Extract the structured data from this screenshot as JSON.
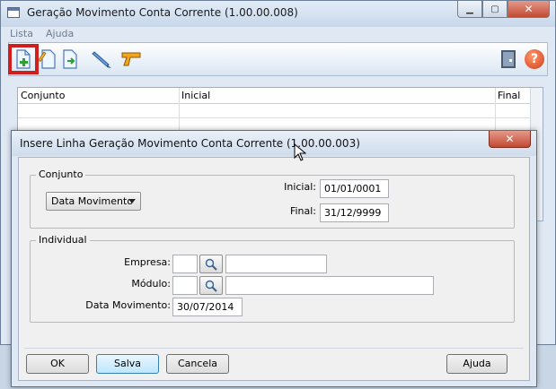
{
  "main_window": {
    "title": "Geração Movimento Conta Corrente (1.00.00.008)",
    "controls": {
      "minimize": "▁",
      "maximize": "▢",
      "close": "✕"
    }
  },
  "menu": {
    "items": [
      "Lista",
      "Ajuda"
    ]
  },
  "toolbar": {
    "icons": [
      "add-document-icon",
      "edit-document-icon",
      "next-document-icon",
      "pencil-icon",
      "gun-icon",
      "exit-door-icon",
      "help-icon"
    ],
    "help_glyph": "?",
    "highlight_color": "#d01e1e"
  },
  "grid": {
    "columns": [
      "Conjunto",
      "Inicial",
      "Final"
    ]
  },
  "dialog": {
    "title": "Insere Linha Geração Movimento Conta Corrente (1.00.00.003)",
    "close_glyph": "✕",
    "conjunto": {
      "legend": "Conjunto",
      "combo_value": "Data Movimento",
      "inicial_label": "Inicial:",
      "inicial_value": "01/01/0001",
      "final_label": "Final:",
      "final_value": "31/12/9999"
    },
    "individual": {
      "legend": "Individual",
      "empresa_label": "Empresa:",
      "empresa_code": "",
      "empresa_name": "",
      "modulo_label": "Módulo:",
      "modulo_code": "",
      "modulo_name": "",
      "data_label": "Data Movimento:",
      "data_value": "30/07/2014"
    },
    "buttons": {
      "ok": "OK",
      "salva": "Salva",
      "cancela": "Cancela",
      "ajuda": "Ajuda"
    }
  }
}
